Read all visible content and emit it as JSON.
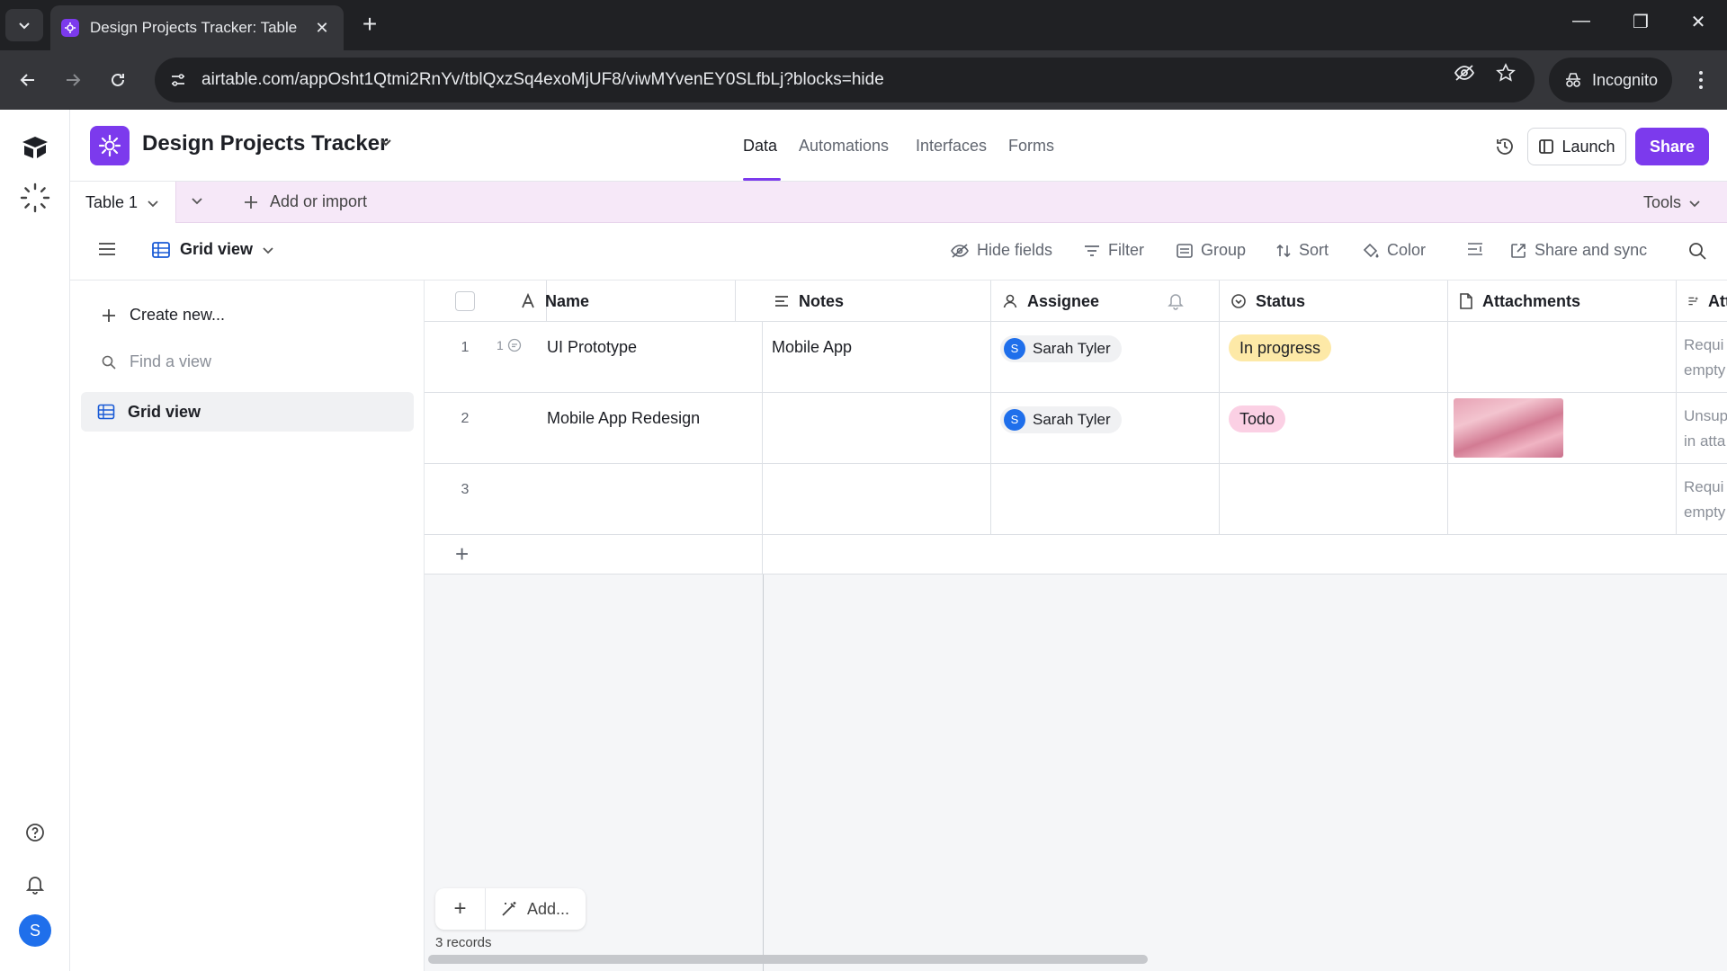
{
  "browser": {
    "tab_title": "Design Projects Tracker: Table 1",
    "url": "airtable.com/appOsht1Qtmi2RnYv/tblQxzSq4exoMjUF8/viwMYvenEY0SLfbLj?blocks=hide",
    "incognito_label": "Incognito"
  },
  "app": {
    "base_name": "Design Projects Tracker",
    "nav_tabs": [
      "Data",
      "Automations",
      "Interfaces",
      "Forms"
    ],
    "active_tab": "Data",
    "launch_label": "Launch",
    "share_label": "Share",
    "brand_color": "#7c3aed"
  },
  "tablebar": {
    "table_name": "Table 1",
    "add_import_label": "Add or import",
    "tools_label": "Tools"
  },
  "viewbar": {
    "view_name": "Grid view",
    "hide_fields": "Hide fields",
    "filter": "Filter",
    "group": "Group",
    "sort": "Sort",
    "color": "Color",
    "share_sync": "Share and sync"
  },
  "sidebar": {
    "create_new": "Create new...",
    "find_placeholder": "Find a view",
    "views": [
      "Grid view"
    ]
  },
  "grid": {
    "columns": [
      "Name",
      "Notes",
      "Assignee",
      "Status",
      "Attachments",
      "Att"
    ],
    "rows": [
      {
        "num": "1",
        "comment_count": "1",
        "name": "UI Prototype",
        "notes": "Mobile App",
        "assignee": "Sarah Tyler",
        "assignee_initial": "S",
        "status": "In progress",
        "status_color": "#fde9a7",
        "has_attachment": false,
        "att_note": "Requi empty"
      },
      {
        "num": "2",
        "comment_count": "",
        "name": "Mobile App Redesign",
        "notes": "",
        "assignee": "Sarah Tyler",
        "assignee_initial": "S",
        "status": "Todo",
        "status_color": "#fbd0e4",
        "has_attachment": true,
        "att_note": "Unsup in atta"
      },
      {
        "num": "3",
        "comment_count": "",
        "name": "",
        "notes": "",
        "assignee": "",
        "assignee_initial": "",
        "status": "",
        "status_color": "",
        "has_attachment": false,
        "att_note": "Requi empty"
      }
    ],
    "add_label": "Add...",
    "record_count": "3 records"
  },
  "user": {
    "initial": "S"
  }
}
